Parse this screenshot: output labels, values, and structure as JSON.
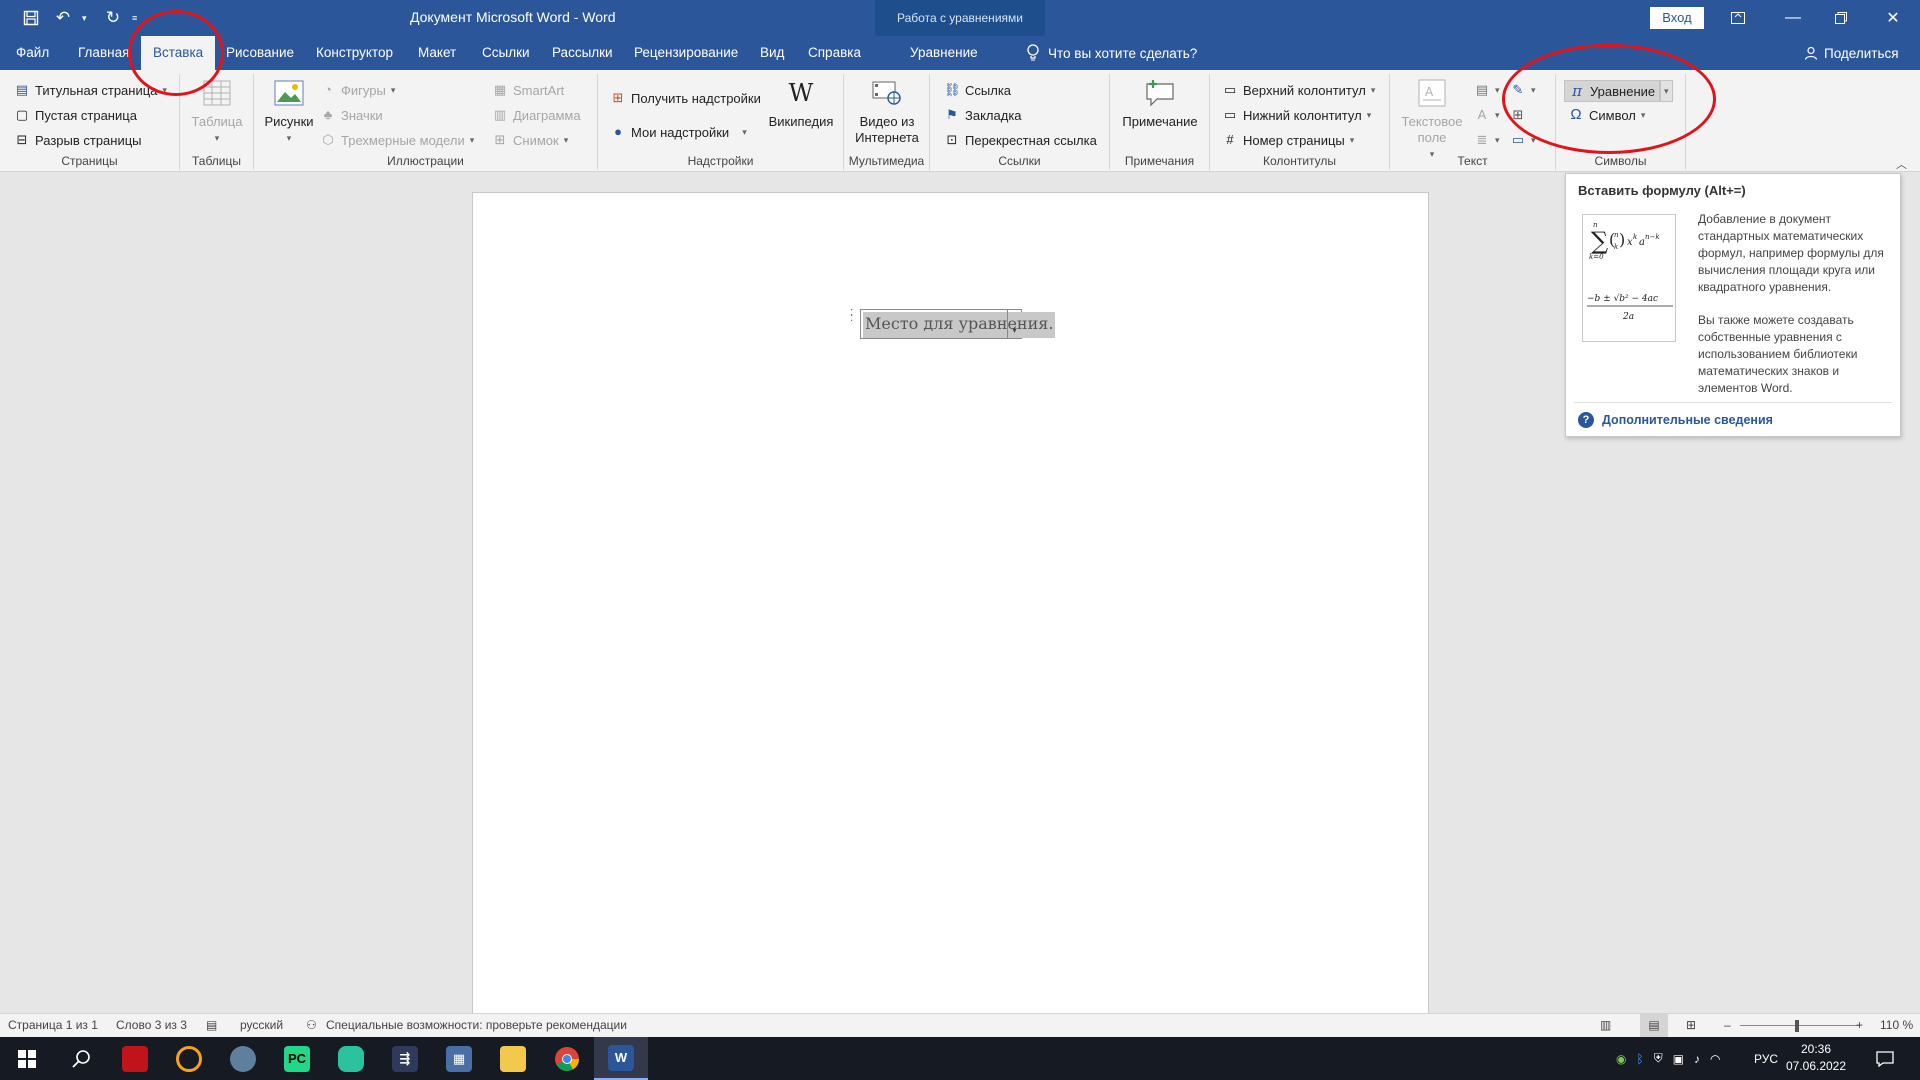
{
  "titlebar": {
    "doc_title": "Документ Microsoft Word  -  Word",
    "context_title": "Работа с уравнениями",
    "signin": "Вход"
  },
  "tabs": [
    {
      "label": "Файл"
    },
    {
      "label": "Главная"
    },
    {
      "label": "Вставка"
    },
    {
      "label": "Рисование"
    },
    {
      "label": "Конструктор"
    },
    {
      "label": "Макет"
    },
    {
      "label": "Ссылки"
    },
    {
      "label": "Рассылки"
    },
    {
      "label": "Рецензирование"
    },
    {
      "label": "Вид"
    },
    {
      "label": "Справка"
    },
    {
      "label": "Уравнение"
    }
  ],
  "tell_me": "Что вы хотите сделать?",
  "share": "Поделиться",
  "ribbon": {
    "pages": {
      "title_page": "Титульная страница",
      "blank_page": "Пустая страница",
      "page_break": "Разрыв страницы",
      "label": "Страницы"
    },
    "tables": {
      "table": "Таблица",
      "label": "Таблицы"
    },
    "illustrations": {
      "pictures": "Рисунки",
      "shapes": "Фигуры",
      "icons": "Значки",
      "models3d": "Трехмерные модели",
      "smartart": "SmartArt",
      "chart": "Диаграмма",
      "screenshot": "Снимок",
      "label": "Иллюстрации"
    },
    "addins": {
      "get": "Получить надстройки",
      "my": "Мои надстройки",
      "wikipedia": "Википедия",
      "label": "Надстройки"
    },
    "media": {
      "video_line1": "Видео из",
      "video_line2": "Интернета",
      "label": "Мультимедиа"
    },
    "links": {
      "link": "Ссылка",
      "bookmark": "Закладка",
      "crossref": "Перекрестная ссылка",
      "label": "Ссылки"
    },
    "comments": {
      "comment": "Примечание",
      "label": "Примечания"
    },
    "headerfooter": {
      "header": "Верхний колонтитул",
      "footer": "Нижний колонтитул",
      "page_number": "Номер страницы",
      "label": "Колонтитулы"
    },
    "text": {
      "textbox_line1": "Текстовое",
      "textbox_line2": "поле",
      "label": "Текст"
    },
    "symbols": {
      "equation": "Уравнение",
      "symbol": "Символ",
      "label": "Символы"
    }
  },
  "document": {
    "equation_placeholder": "Место для уравнения."
  },
  "tooltip": {
    "title": "Вставить формулу (Alt+=)",
    "para1": "Добавление в документ стандартных математических формул, например формулы для вычисления площади круга или квадратного уравнения.",
    "para2": "Вы также можете создавать собственные уравнения с использованием библиотеки математических знаков и элементов Word.",
    "more": "Дополнительные сведения"
  },
  "status": {
    "page": "Страница 1 из 1",
    "words": "Слово 3 из 3",
    "language": "русский",
    "accessibility": "Специальные возможности: проверьте рекомендации",
    "zoom": "110 %",
    "zoom_minus": "–",
    "zoom_plus": "+"
  },
  "taskbar": {
    "lang": "РУС",
    "time": "20:36",
    "date": "07.06.2022",
    "pc_label": "PC"
  },
  "colors": {
    "word_blue": "#2b579a",
    "annotation_red": "#e0141a"
  }
}
